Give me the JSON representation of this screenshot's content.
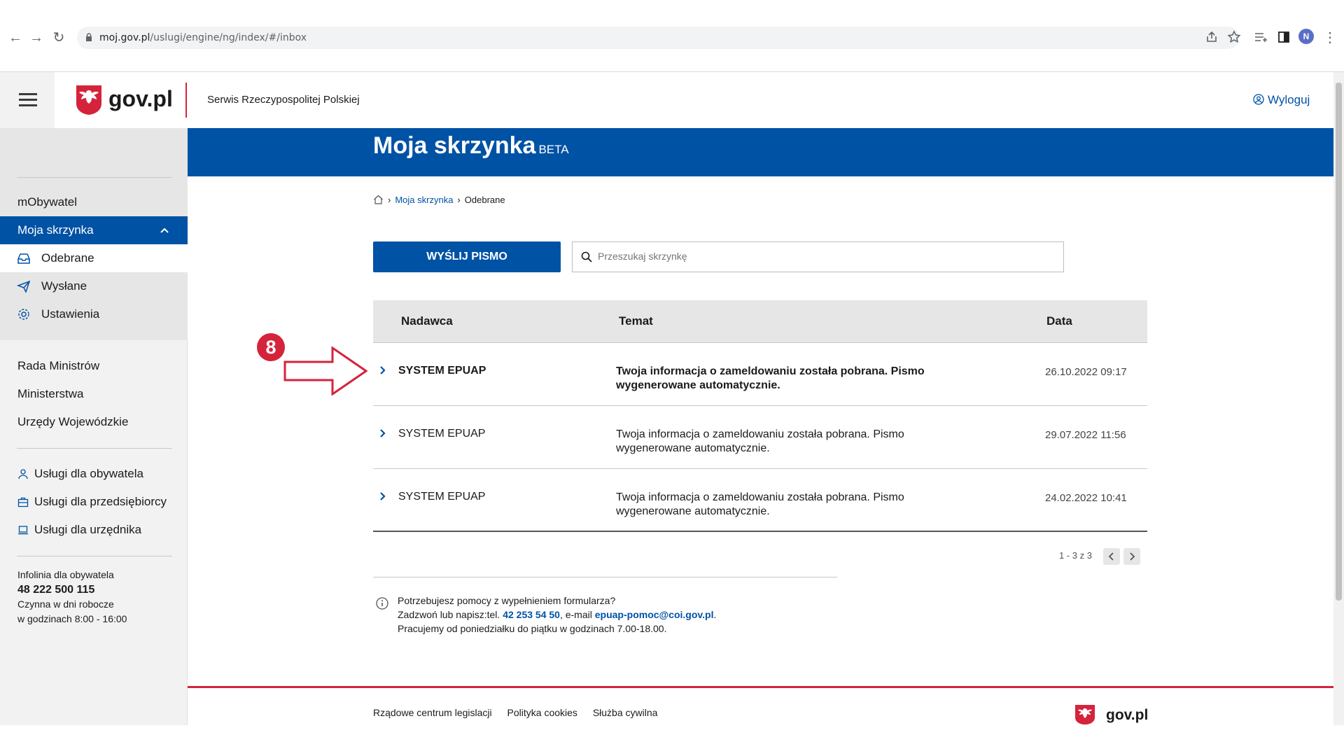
{
  "browser": {
    "url_host": "moj.gov.pl",
    "url_path": "/uslugi/engine/ng/index/#/inbox",
    "avatar_letter": "N"
  },
  "header": {
    "logo": "gov.pl",
    "tagline": "Serwis Rzeczypospolitej Polskiej",
    "logout": "Wyloguj"
  },
  "sidebar": {
    "items": [
      {
        "label": "mObywatel"
      },
      {
        "label": "Moja skrzynka"
      },
      {
        "label": "Odebrane"
      },
      {
        "label": "Wysłane"
      },
      {
        "label": "Ustawienia"
      }
    ],
    "links": [
      {
        "label": "Rada Ministrów"
      },
      {
        "label": "Ministerstwa"
      },
      {
        "label": "Urzędy Wojewódzkie"
      }
    ],
    "services": [
      {
        "label": "Usługi dla obywatela"
      },
      {
        "label": "Usługi dla przedsiębiorcy"
      },
      {
        "label": "Usługi dla urzędnika"
      }
    ],
    "infolinia": {
      "title": "Infolinia dla obywatela",
      "phone": "48 222 500 115",
      "hours_1": "Czynna w dni robocze",
      "hours_2": "w godzinach 8:00 - 16:00"
    }
  },
  "main": {
    "title": "Moja skrzynka",
    "badge": "BETA",
    "breadcrumb": [
      "Moja skrzynka",
      "Odebrane"
    ],
    "send_button": "WYŚLIJ PISMO",
    "search_placeholder": "Przeszukaj skrzynkę",
    "columns": [
      "Nadawca",
      "Temat",
      "Data"
    ],
    "rows": [
      {
        "sender": "SYSTEM EPUAP",
        "subject": "Twoja informacja o zameldowaniu została pobrana. Pismo wygenerowane automatycznie.",
        "date": "26.10.2022 09:17",
        "unread": true
      },
      {
        "sender": "SYSTEM EPUAP",
        "subject": "Twoja informacja o zameldowaniu została pobrana. Pismo wygenerowane automatycznie.",
        "date": "29.07.2022 11:56",
        "unread": false
      },
      {
        "sender": "SYSTEM EPUAP",
        "subject": "Twoja informacja o zameldowaniu została pobrana. Pismo wygenerowane automatycznie.",
        "date": "24.02.2022 10:41",
        "unread": false
      }
    ],
    "pagination": "1 - 3 z 3",
    "help": {
      "line1": "Potrzebujesz pomocy z wypełnieniem formularza?",
      "line2_prefix": "Zadzwoń lub napisz:tel.",
      "phone": "42 253 54 50",
      "line2_mid": ", e-mail",
      "email": "epuap-pomoc@coi.gov.pl",
      "line2_suffix": ".",
      "line3": "Pracujemy od poniedziałku do piątku w godzinach 7.00-18.00."
    }
  },
  "annotation": {
    "number": "8"
  },
  "footer": {
    "links": [
      "Rządowe centrum legislacji",
      "Polityka cookies",
      "Służba cywilna"
    ],
    "logo": "gov.pl"
  },
  "colors": {
    "brand_blue": "#0052a5",
    "accent_red": "#d5233b"
  }
}
